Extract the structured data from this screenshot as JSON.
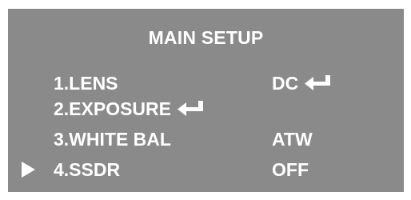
{
  "title": "MAIN SETUP",
  "menu": [
    {
      "label": "1.LENS",
      "value": "DC",
      "label_enter": false,
      "value_enter": true,
      "selected": false
    },
    {
      "label": "2.EXPOSURE",
      "value": "",
      "label_enter": true,
      "value_enter": false,
      "selected": false
    },
    {
      "label": "3.WHITE BAL",
      "value": "ATW",
      "label_enter": false,
      "value_enter": false,
      "selected": false
    },
    {
      "label": "4.SSDR",
      "value": "OFF",
      "label_enter": false,
      "value_enter": false,
      "selected": true
    }
  ],
  "icons": {
    "enter": "enter-icon",
    "cursor": "cursor-arrow-icon"
  },
  "colors": {
    "panel_background": "#8a8a8a",
    "text": "#ffffff"
  }
}
